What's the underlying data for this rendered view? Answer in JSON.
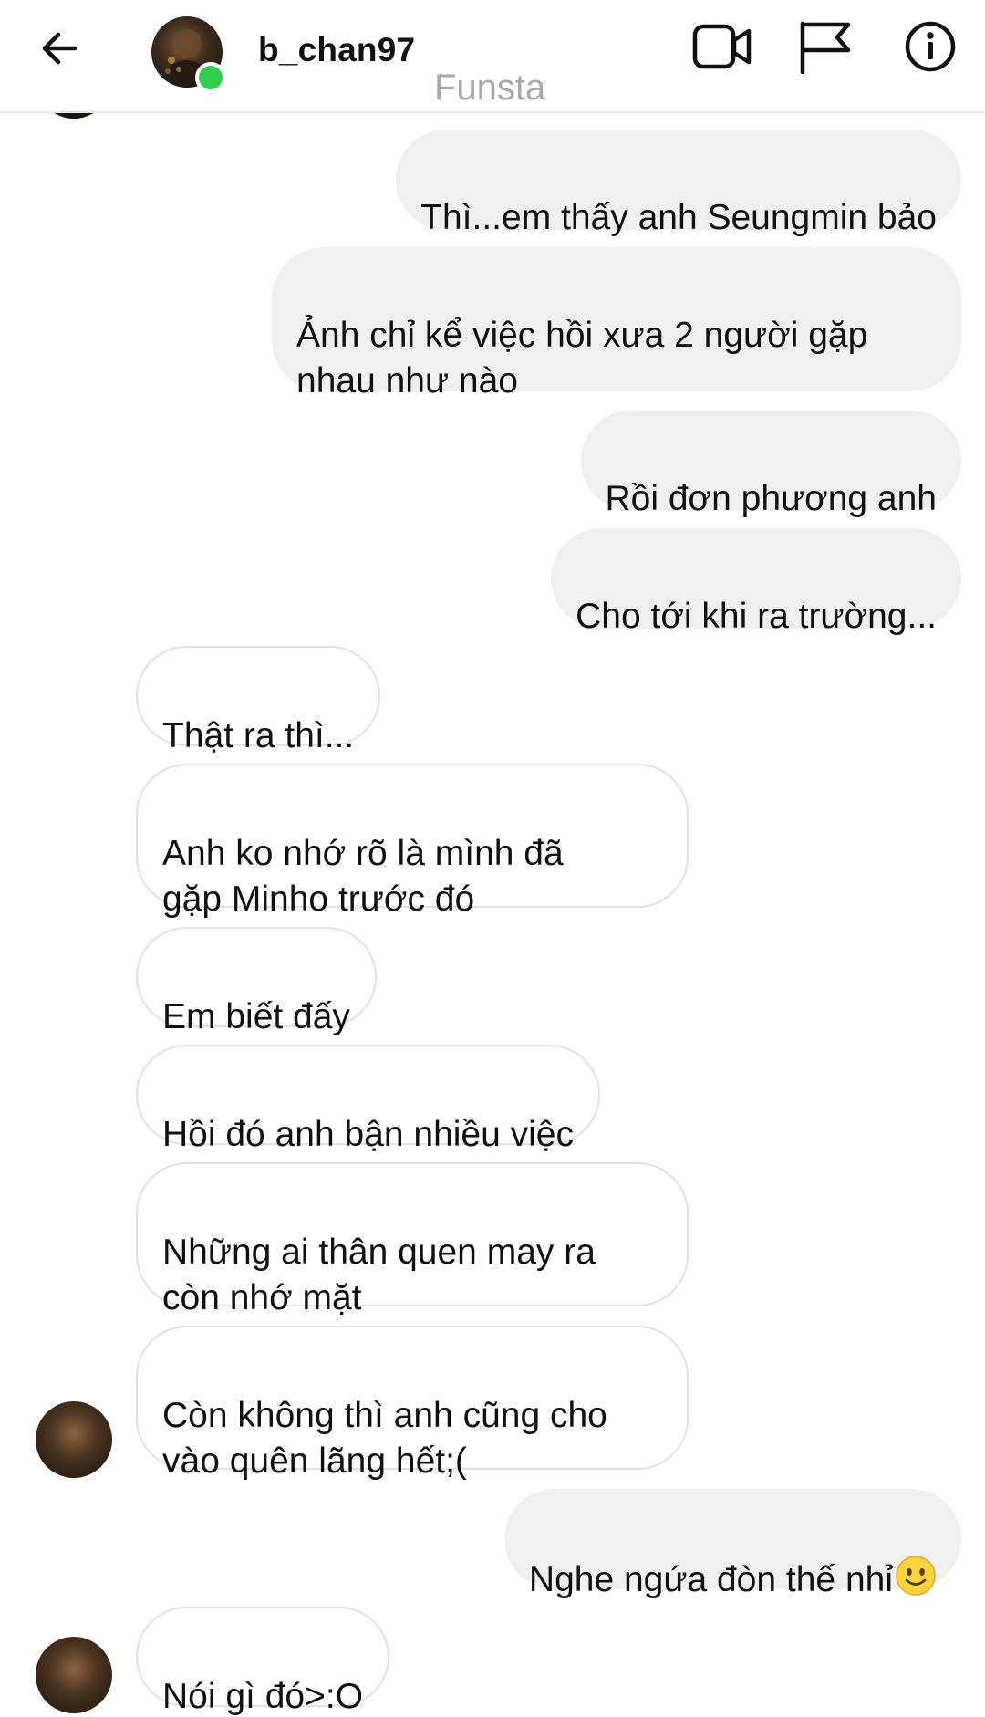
{
  "header": {
    "username": "b_chan97",
    "subtitle": "Funsta",
    "back_icon": "arrow-left-icon",
    "video_icon": "video-call-icon",
    "flag_icon": "flag-icon",
    "info_icon": "info-icon",
    "online_color": "#2ecc50"
  },
  "messages": [
    {
      "side": "out",
      "text": "Thì...em thấy anh Seungmin bảo"
    },
    {
      "side": "out",
      "text": "Ảnh chỉ kể việc hồi xưa 2 người gặp\nnhau như nào"
    },
    {
      "side": "out",
      "text": "Rồi đơn phương anh"
    },
    {
      "side": "out",
      "text": "Cho tới khi ra trường..."
    },
    {
      "side": "in",
      "text": "Thật ra thì..."
    },
    {
      "side": "in",
      "text": "Anh ko nhớ rõ là mình đã\ngặp Minho trước đó"
    },
    {
      "side": "in",
      "text": "Em biết đấy"
    },
    {
      "side": "in",
      "text": "Hồi đó anh bận nhiều việc"
    },
    {
      "side": "in",
      "text": "Những ai thân quen may ra\ncòn nhớ mặt"
    },
    {
      "side": "in",
      "text": "Còn không thì anh cũng cho\nvào quên lãng hết;("
    },
    {
      "side": "out",
      "text": "Nghe ngứa đòn thế nhỉ",
      "emoji": "slightly-smiling-face-icon"
    },
    {
      "side": "in",
      "text": "Nói gì đó>:O"
    }
  ],
  "colors": {
    "outgoing_bubble": "#efefef",
    "incoming_border": "#e2e2e2",
    "text": "#111111",
    "subtitle": "#a8a8a8"
  }
}
